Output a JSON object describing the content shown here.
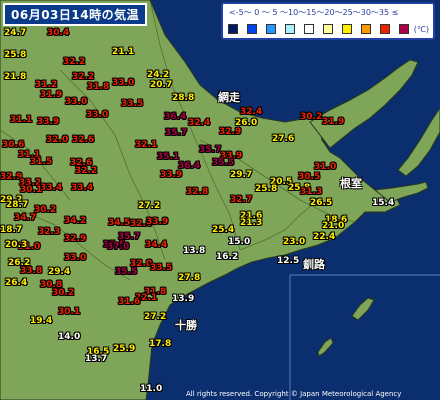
{
  "title": "06月03日14時の気温",
  "legend": {
    "ticks": "<-5〜 0 〜 5 〜10〜15〜20〜25〜30〜35 ≤",
    "unit": "(℃)",
    "colors": [
      "#001a66",
      "#0044ee",
      "#2299ff",
      "#aaeeff",
      "#ffffff",
      "#ffff99",
      "#ffee00",
      "#ff9900",
      "#ee2200",
      "#aa0044"
    ]
  },
  "places": {
    "abashiri": "網走",
    "nemuro": "根室",
    "kushiro": "釧路",
    "tokachi": "十勝"
  },
  "colors": {
    "sea": "#0b2f6e",
    "land": "#7fa658",
    "temp_hot": "#ee2200",
    "temp_warm": "#ffee00",
    "temp_mild": "#ffffff",
    "temp_vhot": "#aa0044"
  },
  "temps": [
    {
      "v": "24.7",
      "c": "#ffee00"
    },
    {
      "v": "30.4",
      "c": "#ee2200"
    },
    {
      "v": "25.8",
      "c": "#ffee00"
    },
    {
      "v": "21.1",
      "c": "#ffee00"
    },
    {
      "v": "32.2",
      "c": "#ee2200"
    },
    {
      "v": "24.2",
      "c": "#ffee00"
    },
    {
      "v": "21.8",
      "c": "#ffee00"
    },
    {
      "v": "31.2",
      "c": "#ee2200"
    },
    {
      "v": "32.2",
      "c": "#ee2200"
    },
    {
      "v": "33.0",
      "c": "#ee2200"
    },
    {
      "v": "20.7",
      "c": "#ffee00"
    },
    {
      "v": "31.9",
      "c": "#ee2200"
    },
    {
      "v": "31.8",
      "c": "#ee2200"
    },
    {
      "v": "33.0",
      "c": "#ee2200"
    },
    {
      "v": "33.5",
      "c": "#ee2200"
    },
    {
      "v": "28.8",
      "c": "#ffee00"
    },
    {
      "v": "32.4",
      "c": "#ee2200"
    },
    {
      "v": "31.1",
      "c": "#ee2200"
    },
    {
      "v": "33.9",
      "c": "#ee2200"
    },
    {
      "v": "33.0",
      "c": "#ee2200"
    },
    {
      "v": "26.0",
      "c": "#ffee00"
    },
    {
      "v": "36.4",
      "c": "#aa0044"
    },
    {
      "v": "32.4",
      "c": "#ee2200"
    },
    {
      "v": "30.2",
      "c": "#ee2200"
    },
    {
      "v": "35.7",
      "c": "#aa0044"
    },
    {
      "v": "32.9",
      "c": "#ee2200"
    },
    {
      "v": "30.6",
      "c": "#ee2200"
    },
    {
      "v": "32.0",
      "c": "#ee2200"
    },
    {
      "v": "32.6",
      "c": "#ee2200"
    },
    {
      "v": "32.1",
      "c": "#ee2200"
    },
    {
      "v": "35.7",
      "c": "#aa0044"
    },
    {
      "v": "27.6",
      "c": "#ffee00"
    },
    {
      "v": "31.9",
      "c": "#ee2200"
    },
    {
      "v": "31.1",
      "c": "#ee2200"
    },
    {
      "v": "33.9",
      "c": "#ee2200"
    },
    {
      "v": "31.5",
      "c": "#ee2200"
    },
    {
      "v": "32.6",
      "c": "#ee2200"
    },
    {
      "v": "35.1",
      "c": "#aa0044"
    },
    {
      "v": "35.5",
      "c": "#aa0044"
    },
    {
      "v": "36.4",
      "c": "#aa0044"
    },
    {
      "v": "31.0",
      "c": "#ee2200"
    },
    {
      "v": "32.9",
      "c": "#ee2200"
    },
    {
      "v": "32.2",
      "c": "#ee2200"
    },
    {
      "v": "33.2",
      "c": "#ee2200"
    },
    {
      "v": "29.7",
      "c": "#ffee00"
    },
    {
      "v": "30.5",
      "c": "#ee2200"
    },
    {
      "v": "20.5",
      "c": "#ffee00"
    },
    {
      "v": "33.4",
      "c": "#ee2200"
    },
    {
      "v": "25.8",
      "c": "#ffee00"
    },
    {
      "v": "25.8",
      "c": "#ffee00"
    },
    {
      "v": "33.4",
      "c": "#ee2200"
    },
    {
      "v": "32.8",
      "c": "#ee2200"
    },
    {
      "v": "31.3",
      "c": "#ee2200"
    },
    {
      "v": "18.6",
      "c": "#ffee00"
    },
    {
      "v": "29.2",
      "c": "#ffee00"
    },
    {
      "v": "32.7",
      "c": "#ee2200"
    },
    {
      "v": "27.2",
      "c": "#ffee00"
    },
    {
      "v": "28.7",
      "c": "#ffee00"
    },
    {
      "v": "26.5",
      "c": "#ffee00"
    },
    {
      "v": "15.4",
      "c": "#ffffff"
    },
    {
      "v": "30.2",
      "c": "#ee2200"
    },
    {
      "v": "34.7",
      "c": "#ee2200"
    },
    {
      "v": "21.6",
      "c": "#ffee00"
    },
    {
      "v": "18.7",
      "c": "#ffee00"
    },
    {
      "v": "21.0",
      "c": "#ffee00"
    },
    {
      "v": "34.2",
      "c": "#ee2200"
    },
    {
      "v": "32.0",
      "c": "#ee2200"
    },
    {
      "v": "33.9",
      "c": "#ee2200"
    },
    {
      "v": "34.5",
      "c": "#ee2200"
    },
    {
      "v": "21.3",
      "c": "#ffee00"
    },
    {
      "v": "25.4",
      "c": "#ffee00"
    },
    {
      "v": "32.3",
      "c": "#ee2200"
    },
    {
      "v": "32.9",
      "c": "#ee2200"
    },
    {
      "v": "35.7",
      "c": "#aa0044"
    },
    {
      "v": "15.0",
      "c": "#ffffff"
    },
    {
      "v": "23.0",
      "c": "#ffee00"
    },
    {
      "v": "22.4",
      "c": "#ffee00"
    },
    {
      "v": "31.0",
      "c": "#ee2200"
    },
    {
      "v": "35.5",
      "c": "#aa0044"
    },
    {
      "v": "37.0",
      "c": "#aa0044"
    },
    {
      "v": "34.4",
      "c": "#ee2200"
    },
    {
      "v": "33.0",
      "c": "#ee2200"
    },
    {
      "v": "29.4",
      "c": "#ffee00"
    },
    {
      "v": "16.2",
      "c": "#ffffff"
    },
    {
      "v": "13.8",
      "c": "#ffffff"
    },
    {
      "v": "12.5",
      "c": "#ffffff"
    },
    {
      "v": "32.0",
      "c": "#ee2200"
    },
    {
      "v": "33.5",
      "c": "#ee2200"
    },
    {
      "v": "33.8",
      "c": "#ee2200"
    },
    {
      "v": "35.5",
      "c": "#aa0044"
    },
    {
      "v": "27.8",
      "c": "#ffee00"
    },
    {
      "v": "26.4",
      "c": "#ffee00"
    },
    {
      "v": "30.8",
      "c": "#ee2200"
    },
    {
      "v": "30.2",
      "c": "#ee2200"
    },
    {
      "v": "31.8",
      "c": "#ee2200"
    },
    {
      "v": "32.1",
      "c": "#ee2200"
    },
    {
      "v": "31.6",
      "c": "#ee2200"
    },
    {
      "v": "13.9",
      "c": "#ffffff"
    },
    {
      "v": "30.1",
      "c": "#ee2200"
    },
    {
      "v": "27.2",
      "c": "#ffee00"
    },
    {
      "v": "19.4",
      "c": "#ffee00"
    },
    {
      "v": "14.0",
      "c": "#ffffff"
    },
    {
      "v": "17.8",
      "c": "#ffee00"
    },
    {
      "v": "16.5",
      "c": "#ffee00"
    },
    {
      "v": "25.9",
      "c": "#ffee00"
    },
    {
      "v": "13.7",
      "c": "#ffffff"
    },
    {
      "v": "11.0",
      "c": "#ffffff"
    },
    {
      "v": "20.3",
      "c": "#ffee00"
    },
    {
      "v": "26.2",
      "c": "#ffee00"
    },
    {
      "v": "30.1",
      "c": "#ee2200"
    },
    {
      "v": "33.9",
      "c": "#ee2200"
    }
  ],
  "copyright": "All rights reserved. Copyright © Japan Meteorological Agency"
}
